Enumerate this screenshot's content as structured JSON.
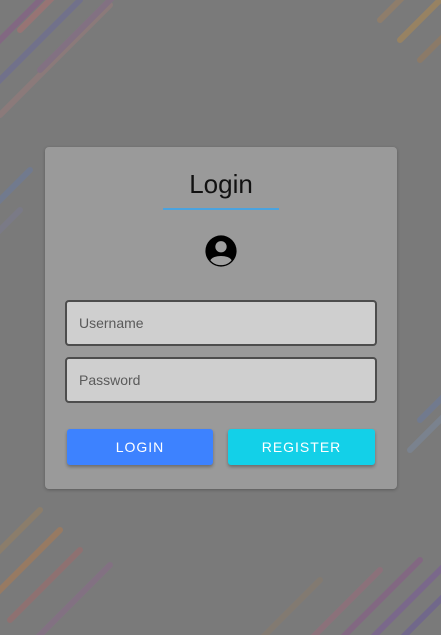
{
  "login_form": {
    "title": "Login",
    "username_placeholder": "Username",
    "password_placeholder": "Password",
    "login_label": "LOGIN",
    "register_label": "REGISTER",
    "avatar_icon": "account-circle-icon"
  },
  "colors": {
    "accent_underline": "#4aa3df",
    "login_button": "#3d82ff",
    "register_button": "#13d0e8"
  }
}
